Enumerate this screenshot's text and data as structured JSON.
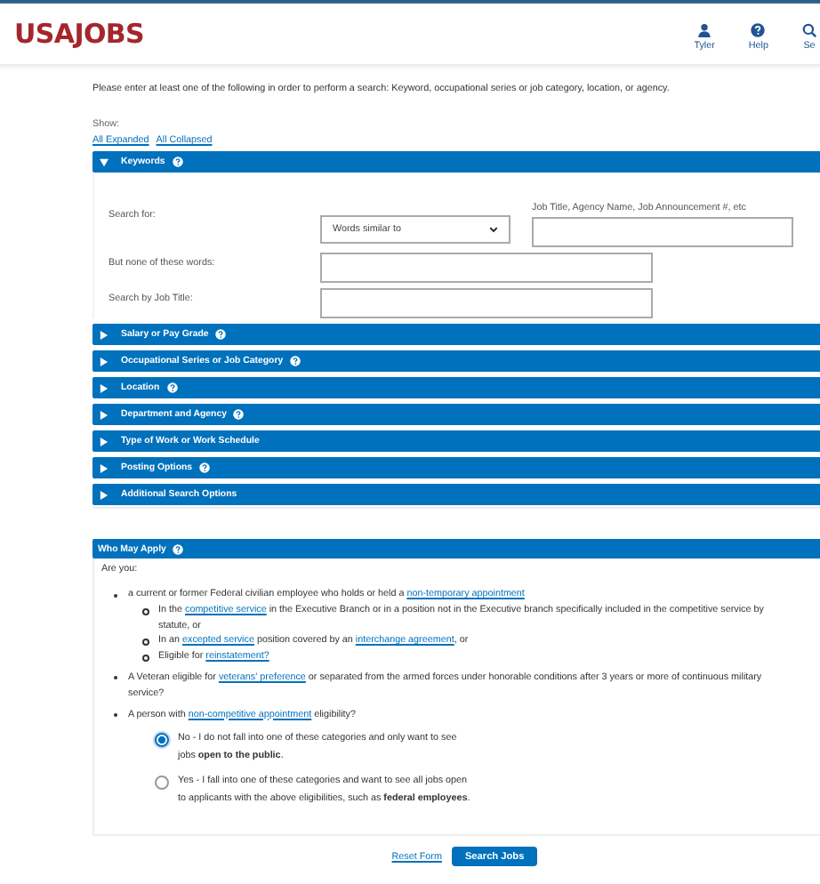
{
  "header": {
    "logo": "USAJOBS",
    "nav": [
      {
        "label": "Tyler",
        "kind": "user"
      },
      {
        "label": "Help",
        "kind": "help"
      },
      {
        "label": "Se",
        "kind": "search"
      }
    ]
  },
  "intro": "Please enter at least one of the following in order to perform a search: Keyword, occupational series or job category, location, or agency.",
  "show": {
    "label": "Show:",
    "links": [
      "All Expanded",
      "All Collapsed"
    ]
  },
  "sections": [
    {
      "title": "Keywords",
      "expanded": true,
      "help": true
    },
    {
      "title": "Salary or Pay Grade",
      "expanded": false,
      "help": true
    },
    {
      "title": "Occupational Series or Job Category",
      "expanded": false,
      "help": true
    },
    {
      "title": "Location",
      "expanded": false,
      "help": true
    },
    {
      "title": "Department and Agency",
      "expanded": false,
      "help": true
    },
    {
      "title": "Type of Work or Work Schedule",
      "expanded": false,
      "help": false
    },
    {
      "title": "Posting Options",
      "expanded": false,
      "help": true
    },
    {
      "title": "Additional Search Options",
      "expanded": false,
      "help": false
    }
  ],
  "keywords": {
    "search_for": "Search for:",
    "mode": "Words similar to",
    "hint": "Job Title, Agency Name, Job Announcement #, etc",
    "exclude_label": "But none of these words:",
    "title_label": "Search by Job Title:"
  },
  "who_may_apply": {
    "title": "Who May Apply",
    "help": true,
    "prompt": "Are you:",
    "items": [
      {
        "segments": [
          {
            "text": "a current or former Federal civilian employee who holds or held a ",
            "link": false
          },
          {
            "text": "non-temporary appointment",
            "link": true
          }
        ],
        "children": [
          {
            "segments": [
              {
                "text": "In the ",
                "link": false
              },
              {
                "text": "competitive service",
                "link": true
              },
              {
                "text": " in the Executive Branch or in a position not in the Executive branch specifically included in the competitive service by statute, or",
                "link": false
              }
            ]
          },
          {
            "segments": [
              {
                "text": "In an ",
                "link": false
              },
              {
                "text": "excepted service",
                "link": true
              },
              {
                "text": " position covered by an ",
                "link": false
              },
              {
                "text": "interchange agreement",
                "link": true
              },
              {
                "text": ", or",
                "link": false
              }
            ]
          },
          {
            "segments": [
              {
                "text": "Eligible for ",
                "link": false
              },
              {
                "text": "reinstatement?",
                "link": true
              }
            ]
          }
        ]
      },
      {
        "segments": [
          {
            "text": "A Veteran eligible for ",
            "link": false
          },
          {
            "text": "veterans' preference",
            "link": true
          },
          {
            "text": " or separated from the armed forces under honorable conditions after 3 years or more of continuous military service?",
            "link": false
          }
        ]
      },
      {
        "segments": [
          {
            "text": "A person with ",
            "link": false
          },
          {
            "text": "non-competitive appointment",
            "link": true
          },
          {
            "text": " eligibility?",
            "link": false
          }
        ]
      }
    ],
    "options": [
      {
        "text": "No - I do not fall into one of these categories and only want to see jobs **open to the public**.",
        "selected": true
      },
      {
        "text": "Yes - I fall into one of these categories and want to see all jobs open to applicants with the above eligibilities, such as **federal employees**.",
        "selected": false
      }
    ]
  },
  "buttons": {
    "reset": "Reset Form",
    "search": "Search Jobs"
  }
}
